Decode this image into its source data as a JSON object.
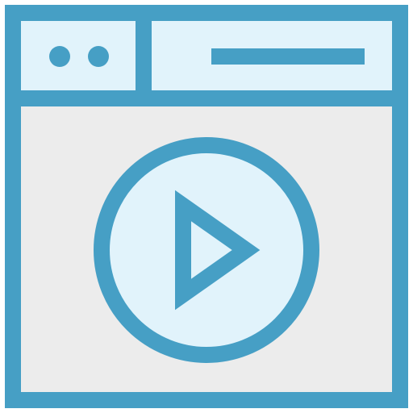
{
  "icon": {
    "name": "video-player-window-icon",
    "colors": {
      "stroke": "#469FC5",
      "header_fill": "#E1F3FB",
      "body_fill": "#ECECEC",
      "play_circle_fill": "#E1F3FB"
    }
  }
}
